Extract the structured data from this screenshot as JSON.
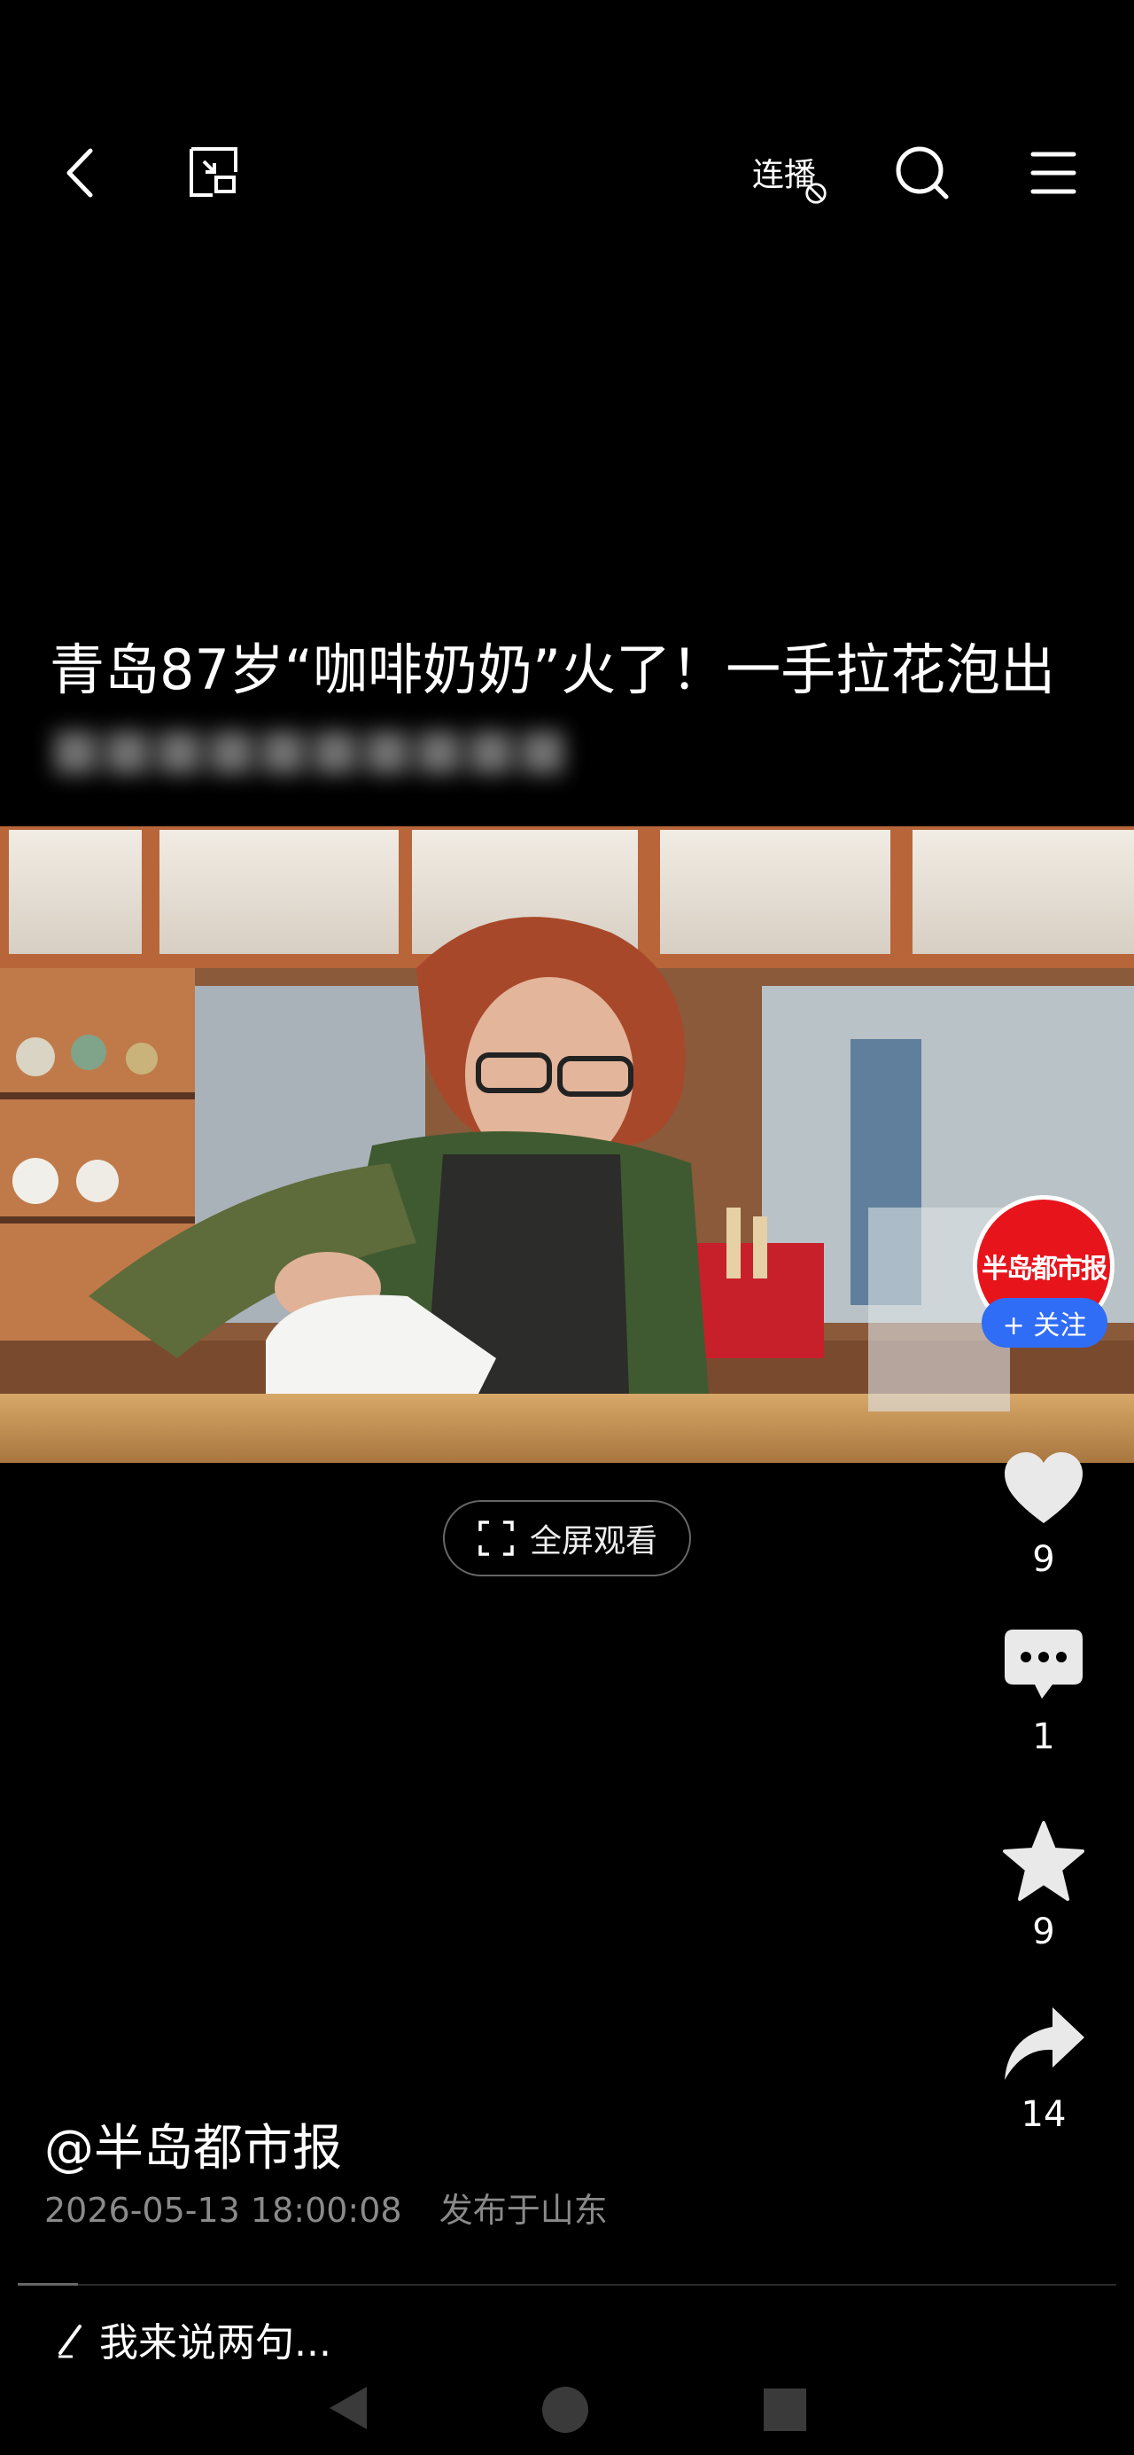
{
  "top_bar": {
    "back_icon": "chevron-left-icon",
    "pip_icon": "minimize-window-icon",
    "autoplay_label": "连播",
    "search_icon": "search-icon",
    "menu_icon": "hamburger-menu-icon"
  },
  "video": {
    "title": "青岛87岁“咖啡奶奶”火了！一手拉花泡出",
    "fullscreen_label": "全屏观看"
  },
  "sidebar": {
    "avatar_text": "半岛都市报",
    "follow_label": "+ 关注",
    "likes": "9",
    "comments": "1",
    "favorites": "9",
    "shares": "14"
  },
  "post": {
    "author": "@半岛都市报",
    "timestamp": "2026-05-13 18:00:08",
    "location": "发布于山东"
  },
  "comment_bar": {
    "placeholder": "我来说两句..."
  },
  "colors": {
    "background": "#000000",
    "follow_button": "#2f6df6",
    "avatar": "#e8141c",
    "meta_text": "#8a8a8a"
  }
}
